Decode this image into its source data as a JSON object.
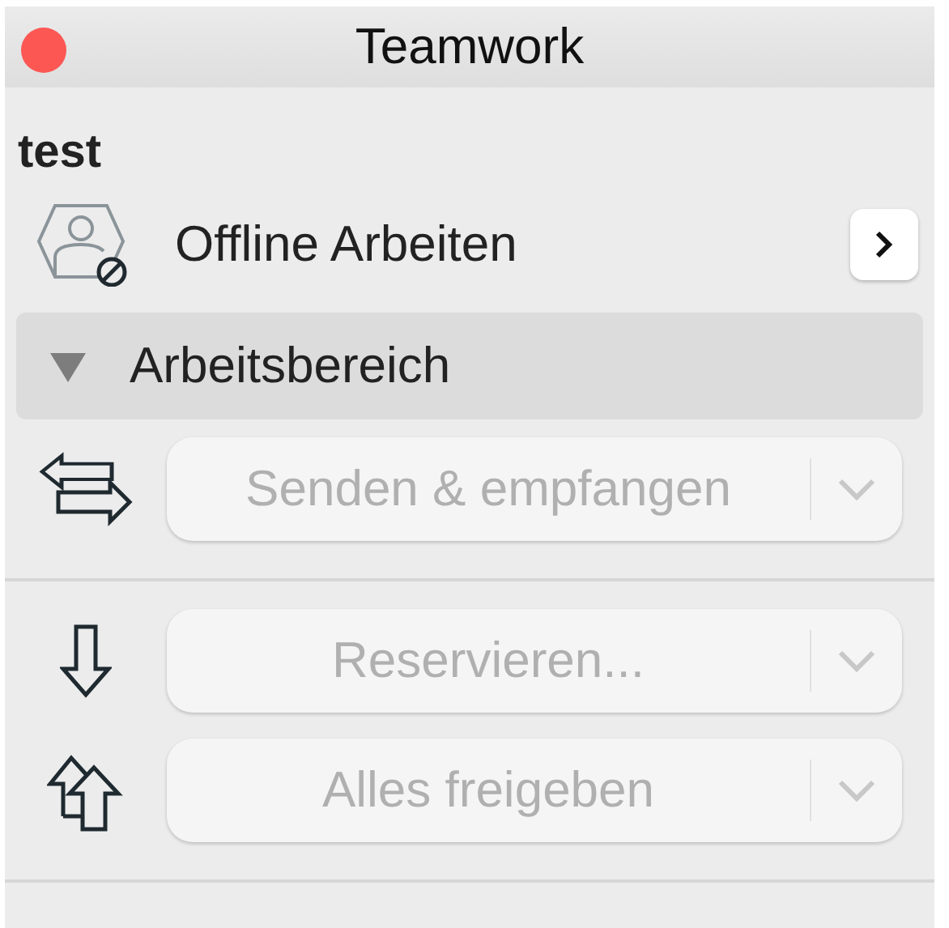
{
  "window": {
    "title": "Teamwork"
  },
  "project": "test",
  "offline": {
    "label": "Offline Arbeiten"
  },
  "section": {
    "label": "Arbeitsbereich",
    "expanded": true
  },
  "action_groups": [
    [
      {
        "kind": "send_receive",
        "label": "Senden & empfangen",
        "disabled": true
      }
    ],
    [
      {
        "kind": "reserve",
        "label": "Reservieren...",
        "disabled": true
      },
      {
        "kind": "release_all",
        "label": "Alles freigeben",
        "disabled": true
      }
    ]
  ]
}
